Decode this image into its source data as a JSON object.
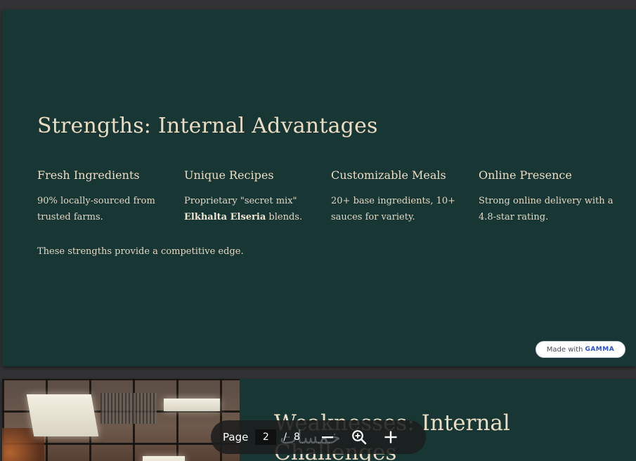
{
  "slide1": {
    "title": "Strengths: Internal Advantages",
    "columns": [
      {
        "heading": "Fresh Ingredients",
        "text": "90% locally-sourced from trusted farms."
      },
      {
        "heading": "Unique Recipes",
        "text_before": "Proprietary \"secret mix\"",
        "text_bold": "Elkhalta Elseria",
        "text_after": "blends."
      },
      {
        "heading": "Customizable Meals",
        "text": "20+ base ingredients, 10+ sauces for variety."
      },
      {
        "heading": "Online Presence",
        "text": "Strong online delivery with a 4.8-star rating."
      }
    ],
    "footer": "These strengths provide a competitive edge.",
    "badge": {
      "prefix": "Made with",
      "brand": "GAMMA"
    }
  },
  "slide2": {
    "title": "Weaknesses: Internal Challenges"
  },
  "toolbar": {
    "page_label": "Page",
    "current_page": "2",
    "separator": "/",
    "total_pages": "8",
    "zoom_out_icon": "minus-icon",
    "zoom_icon": "magnifier-plus-icon",
    "zoom_in_icon": "plus-icon"
  },
  "watermark": "خمسات",
  "colors": {
    "slide_bg": "#173634",
    "slide_text": "#ecdcc4",
    "badge_brand": "#2b4fd0"
  }
}
